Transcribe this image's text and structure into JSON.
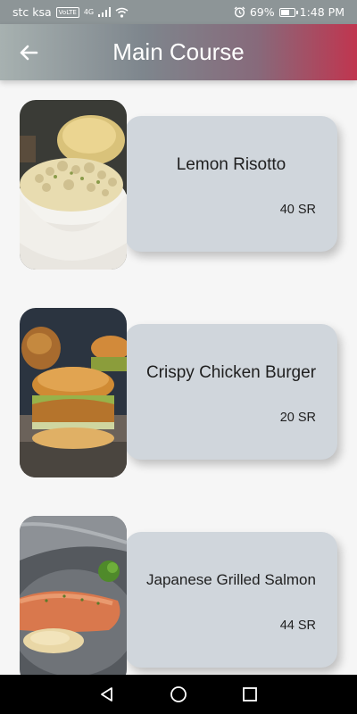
{
  "status_bar": {
    "carrier": "stc ksa",
    "volte": "VoLTE",
    "network": "4G",
    "battery_percent": "69%",
    "battery_level": 0.69,
    "time": "1:48 PM"
  },
  "header": {
    "title": "Main Course",
    "back_icon": "arrow-left-icon"
  },
  "menu_items": [
    {
      "name": "Lemon Risotto",
      "price": "40 SR"
    },
    {
      "name": "Crispy Chicken Burger",
      "price": "20 SR"
    },
    {
      "name": "Japanese Grilled Salmon",
      "price": "44 SR"
    }
  ],
  "nav_bar": {
    "back_icon": "triangle-back-icon",
    "home_icon": "circle-home-icon",
    "recents_icon": "square-recents-icon"
  },
  "colors": {
    "card": "#d0d6dc",
    "header_start": "#a7b1b0",
    "header_end": "#c0354f"
  }
}
